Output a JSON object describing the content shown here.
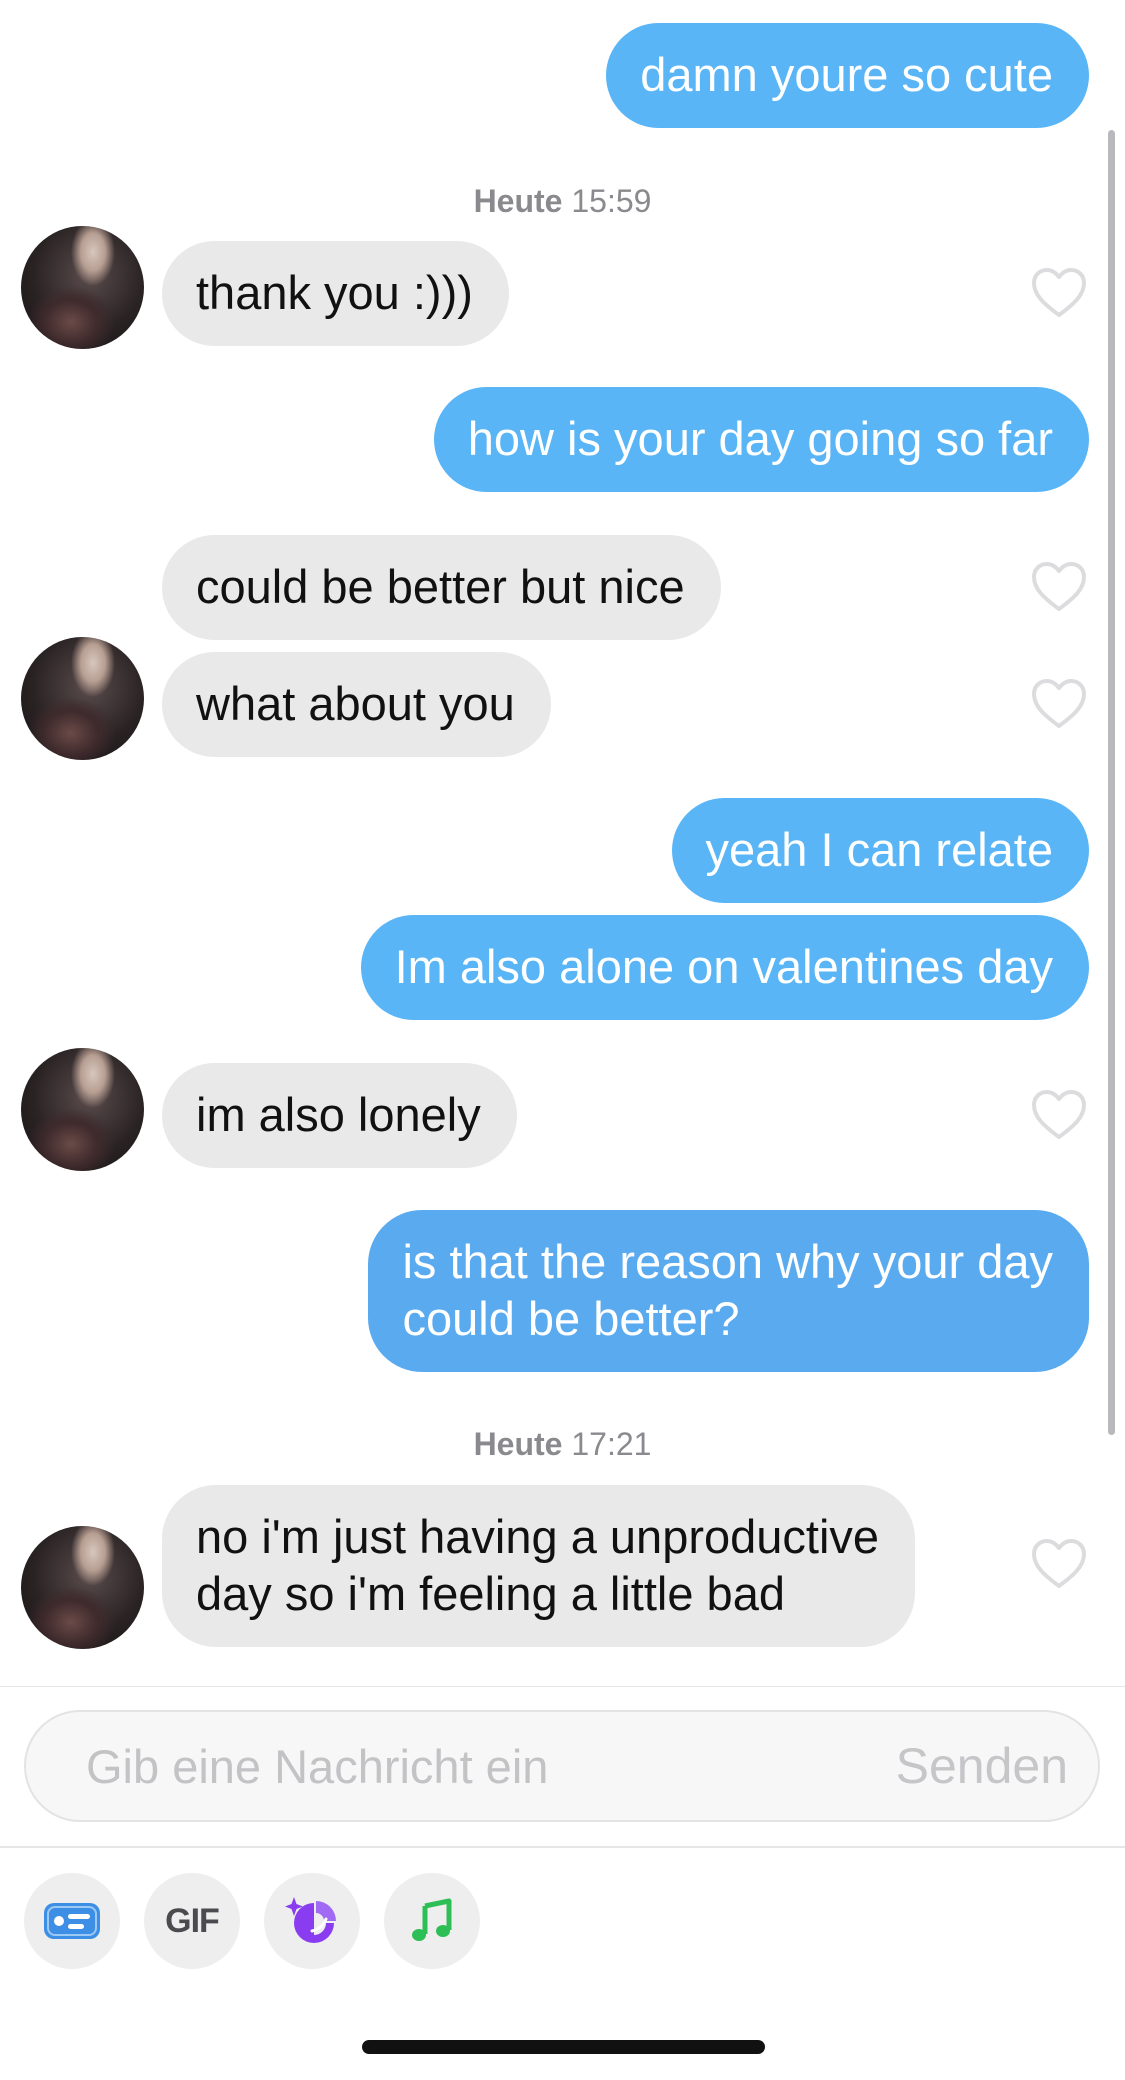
{
  "messages": {
    "m1": "damn youre so cute",
    "m2": "thank you :)))",
    "m3": "how is your day going so far",
    "m4": "could be better but nice",
    "m5": "what about you",
    "m6": "yeah I can relate",
    "m7": "Im also alone on valentines day",
    "m8": "im also lonely",
    "m9_line1": "is that the reason why your day",
    "m9_line2": "could be better?",
    "m10_line1": "no i'm just having a unproductive",
    "m10_line2": "day so i'm feeling a little bad"
  },
  "timestamps": {
    "t1_day": "Heute",
    "t1_time": "15:59",
    "t2_day": "Heute",
    "t2_time": "17:21"
  },
  "composer": {
    "placeholder": "Gib eine Nachricht ein",
    "send_label": "Senden"
  },
  "toolbar": {
    "gif_label": "GIF"
  },
  "icons": {
    "like": "heart-outline-icon",
    "card": "profile-card-icon",
    "sticker": "sparkle-sticker-icon",
    "music": "music-note-icon"
  },
  "colors": {
    "outgoing_bubble": "#59b5f6",
    "incoming_bubble": "#e9e9ea",
    "card_icon": "#3d8fe6",
    "sticker_icon": "#8a3df0",
    "music_icon": "#2dbe55"
  }
}
